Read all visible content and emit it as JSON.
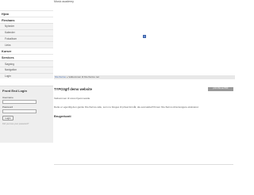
{
  "site": {
    "title": "Music academy"
  },
  "sidebar": {
    "sections": [
      {
        "heading": "Hjem",
        "items": []
      },
      {
        "heading": "Fleshans",
        "items": [
          "Nyheder",
          "Kalender",
          "Fotoalbum",
          "Links"
        ]
      },
      {
        "heading": "Kurser",
        "items": []
      },
      {
        "heading": "Services",
        "items": [
          "Søgning",
          "Navigation",
          "Login"
        ]
      }
    ]
  },
  "login": {
    "title": "Front End Login",
    "username_label": "Username",
    "password_label": "Password",
    "button_label": "Login",
    "forgot_text": "Did you lose your password?"
  },
  "breadcrumb": {
    "link": "fize ftarmo",
    "separator": "»",
    "current": "Velkommen til fize ftarmo net"
  },
  "meta_badge": "print this as PDF",
  "content": {
    "title": "TYPO3gtf demo website",
    "para1": "Velkommen til vores hjemmeside.",
    "para2": "Dette er egentlig den gamle fize ftarmo-side, som nu bruges til privat formål, da oversættelf ftrmen fize ftarmo Aria længere eksisterer.",
    "subheading": "Brugerkonti"
  },
  "icons": {
    "small": "page-icon"
  },
  "colors": {
    "link": "#4f73b5",
    "sidebar_item_bg": "#f3f3f3",
    "login_bg": "#eeeeee"
  }
}
